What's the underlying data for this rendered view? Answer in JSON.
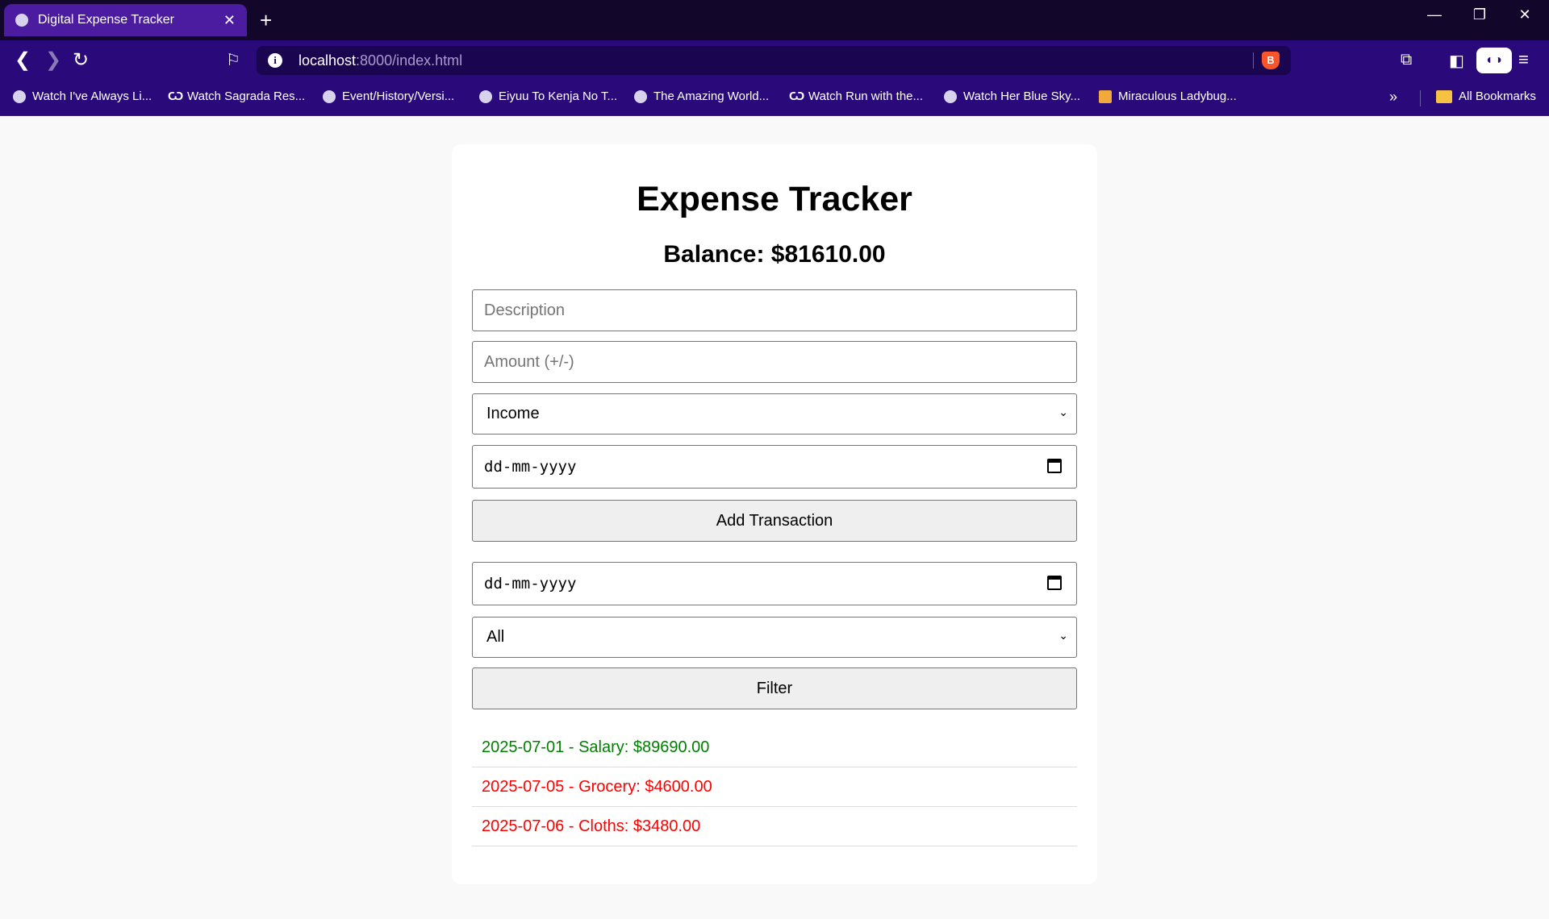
{
  "browser": {
    "tab_title": "Digital Expense Tracker",
    "url_host": "localhost",
    "url_path": ":8000/index.html",
    "bookmarks": [
      "Watch I've Always Li...",
      "Watch Sagrada Res...",
      "Event/History/Versi...",
      "Eiyuu To Kenja No T...",
      "The Amazing World...",
      "Watch Run with the...",
      "Watch Her Blue Sky...",
      "Miraculous Ladybug..."
    ],
    "all_bookmarks": "All Bookmarks"
  },
  "app": {
    "title": "Expense Tracker",
    "balance": "Balance: $81610.00",
    "description_placeholder": "Description",
    "amount_placeholder": "Amount (+/-)",
    "type_selected": "Income",
    "date_value": "dd-mm-yyyy",
    "add_button": "Add Transaction",
    "filter_date_value": "dd-mm-yyyy",
    "filter_type_selected": "All",
    "filter_button": "Filter",
    "transactions": [
      {
        "text": "2025-07-01 - Salary: $89690.00",
        "color": "#008000"
      },
      {
        "text": "2025-07-05 - Grocery: $4600.00",
        "color": "#ff0000"
      },
      {
        "text": "2025-07-06 - Cloths: $3480.00",
        "color": "#ff0000"
      }
    ]
  },
  "colors": {
    "titlebar": "#12062b",
    "toolbar": "#2a0a7a",
    "active_tab": "#4c1ca0",
    "income": "#008000",
    "expense": "#ff0000"
  }
}
